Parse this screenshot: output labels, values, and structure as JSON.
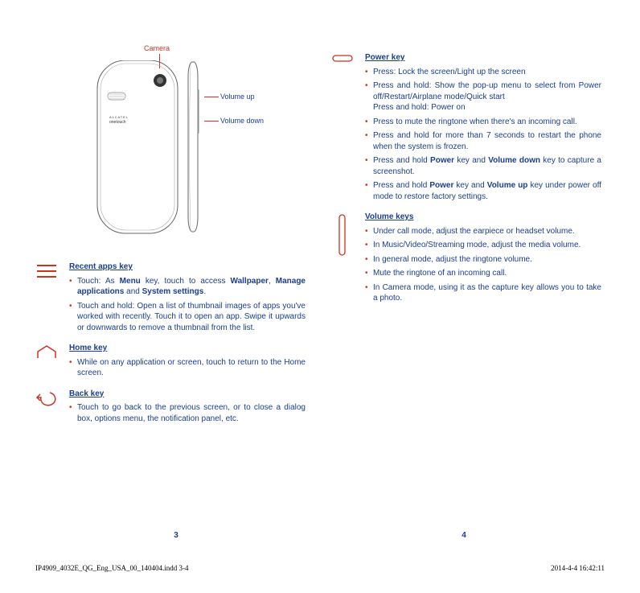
{
  "diagram": {
    "camera": "Camera",
    "volume_up": "Volume up",
    "volume_down": "Volume down",
    "brand": "ALCATEL",
    "sub": "onetouch"
  },
  "left_sections": [
    {
      "title": "Recent apps key",
      "items": [
        "Touch:  As <b>Menu</b> key, touch to access <b>Wallpaper</b>, <b>Manage applications</b> and <b>System settings</b>.",
        "Touch and hold: Open a list of thumbnail images of apps you've worked with recently. Touch it to open an app. Swipe it upwards or downwards to remove a thumbnail from the list."
      ]
    },
    {
      "title": "Home key",
      "items": [
        "While on any application or screen,  touch to return to the Home screen."
      ]
    },
    {
      "title": "Back key",
      "items": [
        "Touch to go back to the previous screen, or to close a dialog box, options menu, the notification panel, etc."
      ]
    }
  ],
  "right_sections": [
    {
      "title": "Power key",
      "items": [
        "Press: Lock the screen/Light up the screen",
        "Press and hold: Show the pop-up menu to select from Power off/Restart/Airplane mode/Quick start<br>Press and hold: Power on",
        "Press to mute the ringtone when there's an incoming call.",
        "Press and hold for more than 7 seconds to restart the phone when the system is frozen.",
        "Press and hold <b>Power</b> key and <b>Volume down</b> key to capture a screenshot.",
        "Press and hold <b>Power</b> key and <b>Volume up</b> key under power off mode to restore factory settings."
      ]
    },
    {
      "title": "Volume keys",
      "items": [
        "Under call mode, adjust the earpiece or headset volume.",
        "In Music/Video/Streaming mode, adjust the media volume.",
        "In general mode, adjust the ringtone volume.",
        "Mute the ringtone of an incoming call.",
        "In Camera mode, using it as the capture key allows you to take a photo."
      ]
    }
  ],
  "page_num_left": "3",
  "page_num_right": "4",
  "footer_left": "IP4909_4032E_QG_Eng_USA_00_140404.indd   3-4",
  "footer_right": "2014-4-4   16:42:11"
}
